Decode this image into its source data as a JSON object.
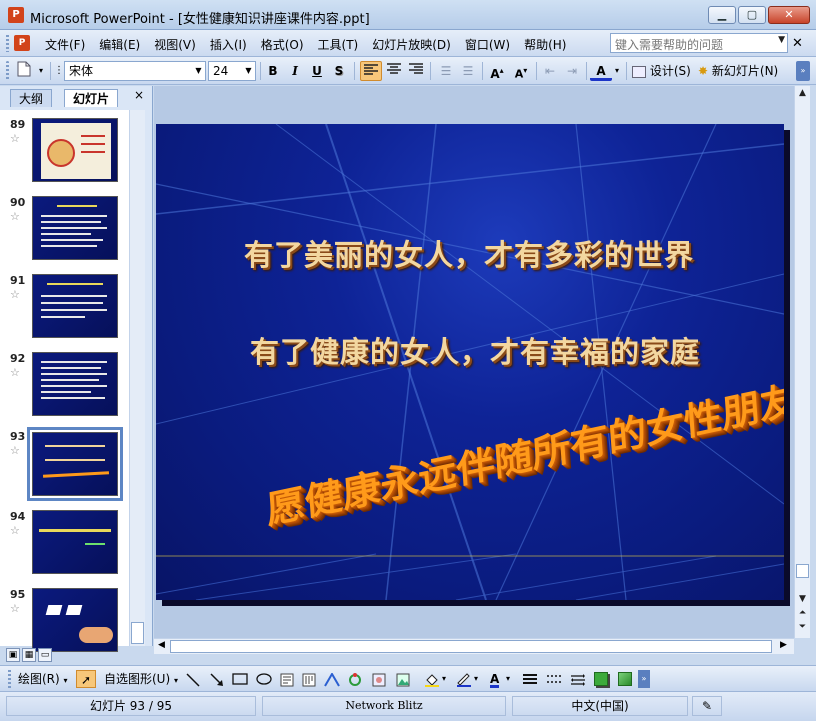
{
  "window": {
    "title": "Microsoft PowerPoint - [女性健康知识讲座课件内容.ppt]",
    "app_icon_label": "P",
    "minimize": "▁",
    "maximize": "▢",
    "close": "✕"
  },
  "menubar": {
    "items": [
      "文件(F)",
      "编辑(E)",
      "视图(V)",
      "插入(I)",
      "格式(O)",
      "工具(T)",
      "幻灯片放映(D)",
      "窗口(W)",
      "帮助(H)"
    ],
    "help_placeholder": "键入需要帮助的问题",
    "close_doc": "✕"
  },
  "toolbar": {
    "font_name": "宋体",
    "font_size": "24",
    "bold": "B",
    "italic": "I",
    "underline": "U",
    "shadow": "S",
    "design_label": "设计(S)",
    "new_slide_label": "新幻灯片(N)"
  },
  "left_pane": {
    "tab_outline": "大纲",
    "tab_slides": "幻灯片",
    "close": "×",
    "thumbnails": [
      {
        "number": "89",
        "selected": false
      },
      {
        "number": "90",
        "selected": false
      },
      {
        "number": "91",
        "selected": false
      },
      {
        "number": "92",
        "selected": false
      },
      {
        "number": "93",
        "selected": true
      },
      {
        "number": "94",
        "selected": false
      },
      {
        "number": "95",
        "selected": false
      }
    ],
    "transition_icon": "☆"
  },
  "slide": {
    "line1": "有了美丽的女人，才有多彩的世界",
    "line2": "有了健康的女人，才有幸福的家庭",
    "wordart": "愿健康永远伴随所有的女性朋友"
  },
  "drawbar": {
    "draw_label": "绘图(R)",
    "autoshapes_label": "自选图形(U)"
  },
  "status": {
    "slide_position": "幻灯片 93 / 95",
    "design_template": "Network Blitz",
    "language": "中文(中国)"
  }
}
